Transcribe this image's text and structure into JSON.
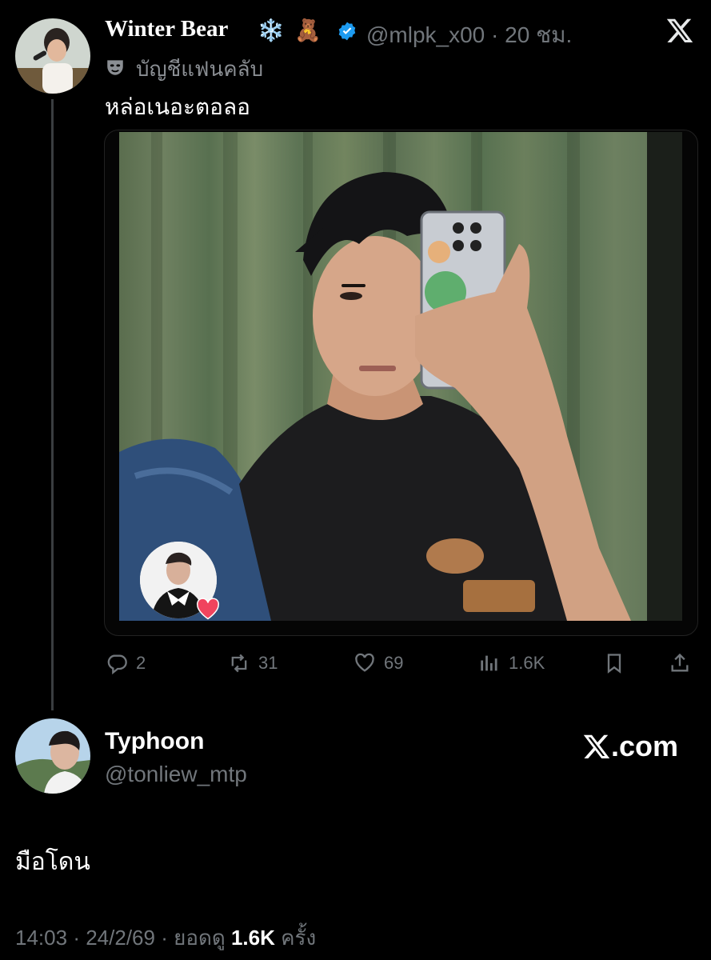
{
  "tweet": {
    "author_name": "Winter Bear",
    "name_emojis": [
      "❄️",
      "🧸"
    ],
    "handle": "@mlpk_x00",
    "separator": "·",
    "time_ago": "20 ชม.",
    "fan_account_label": "บัญชีแฟนคลับ",
    "text": "หล่อเนอะตอลอ",
    "media_alt": "Mirror selfie photo",
    "actions": {
      "replies": "2",
      "reposts": "31",
      "likes": "69",
      "views": "1.6K"
    }
  },
  "reply": {
    "author_name": "Typhoon",
    "handle": "@tonliew_mtp",
    "text": "มือโดน",
    "time": "14:03",
    "date": "24/2/69",
    "views_label": "ยอดดู",
    "views": "1.6K",
    "views_suffix": "ครั้ง",
    "dot": "·"
  },
  "brand": {
    "watermark": ".com"
  },
  "colors": {
    "background": "#000000",
    "muted": "#71767b",
    "verified": "#1d9bf0",
    "text": "#e7e9ea"
  }
}
